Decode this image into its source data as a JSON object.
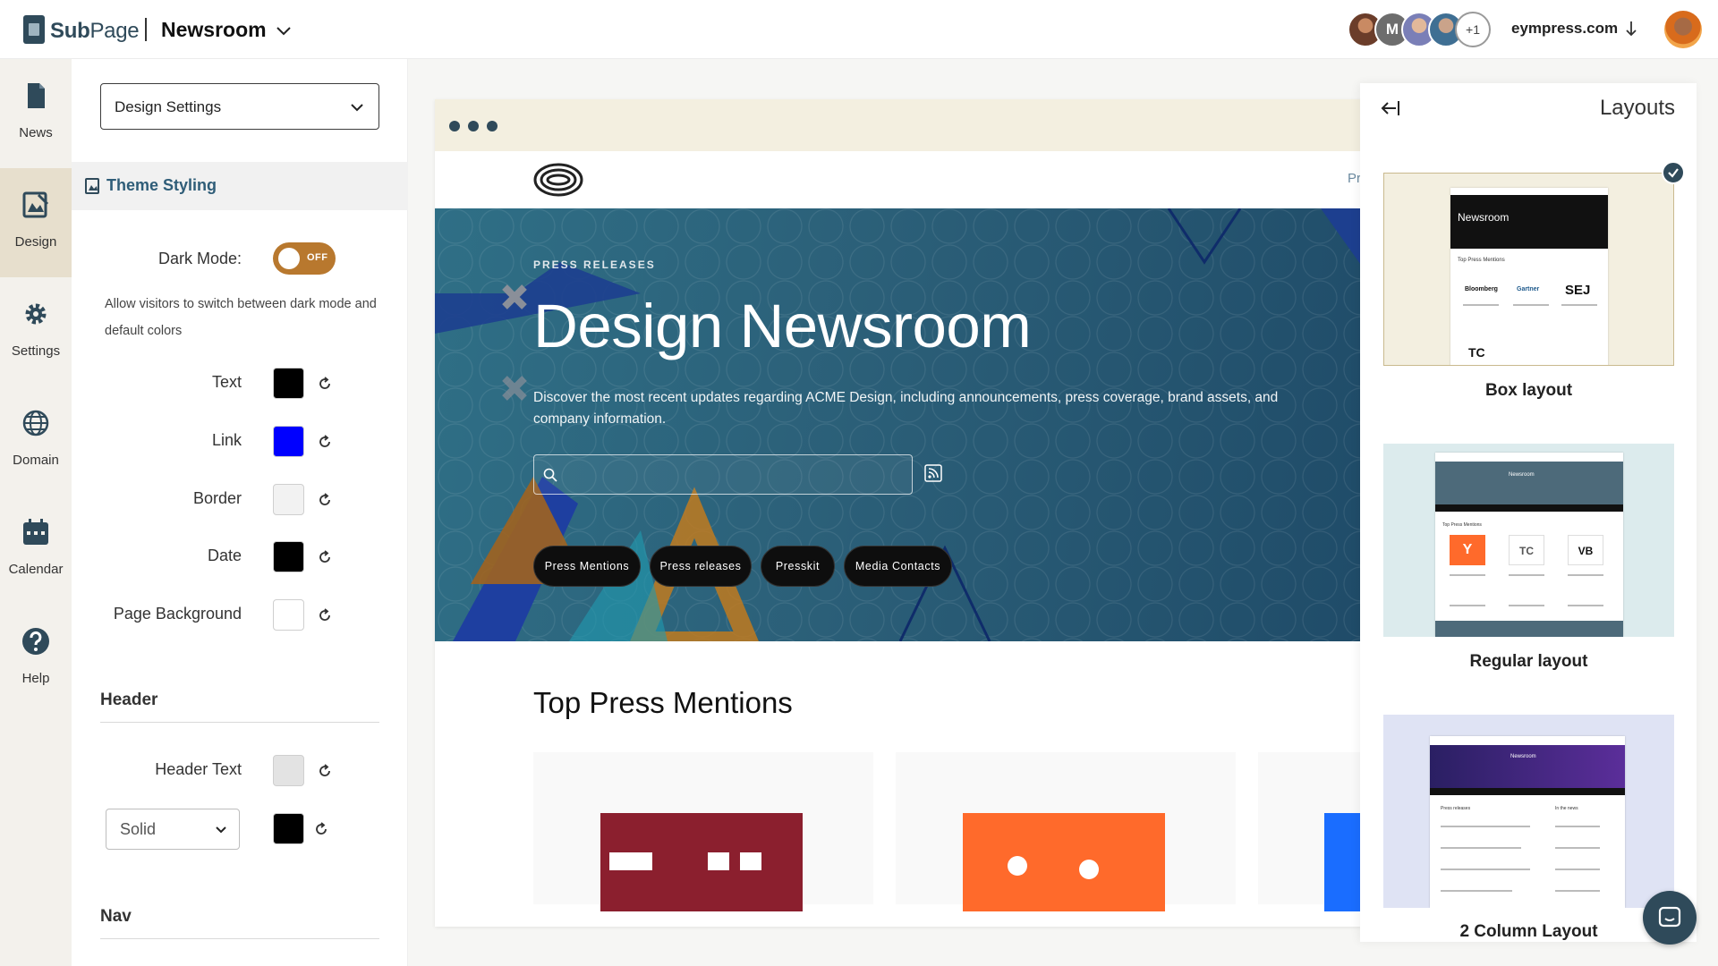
{
  "topbar": {
    "brand_bold": "Sub",
    "brand_light": "Page",
    "project_title": "Newsroom",
    "avatars": [
      {
        "initial": "",
        "icon": "user-photo-icon"
      },
      {
        "initial": "M",
        "icon": "user-initial-avatar"
      },
      {
        "initial": "",
        "icon": "user-photo-icon"
      },
      {
        "initial": "",
        "icon": "user-photo-icon"
      }
    ],
    "avatars_more": "+1",
    "domain": "eympress.com"
  },
  "rail": {
    "items": [
      {
        "label": "News",
        "icon": "document-icon",
        "active": false
      },
      {
        "label": "Design",
        "icon": "design-icon",
        "active": true
      },
      {
        "label": "Settings",
        "icon": "gear-icon",
        "active": false
      },
      {
        "label": "Domain",
        "icon": "globe-icon",
        "active": false
      },
      {
        "label": "Calendar",
        "icon": "calendar-icon",
        "active": false
      },
      {
        "label": "Help",
        "icon": "help-icon",
        "active": false
      }
    ]
  },
  "panel": {
    "select_value": "Design Settings",
    "section_title": "Theme Styling",
    "dark_mode_label": "Dark Mode:",
    "dark_mode_state": "OFF",
    "dark_mode_help": "Allow visitors to switch between dark mode and default colors",
    "colors": [
      {
        "label": "Text",
        "value": "#000000"
      },
      {
        "label": "Link",
        "value": "#0000ff"
      },
      {
        "label": "Border",
        "value": "#f2f2f2"
      },
      {
        "label": "Date",
        "value": "#000000"
      },
      {
        "label": "Page Background",
        "value": "#ffffff"
      }
    ],
    "header_group": "Header",
    "header_text_label": "Header Text",
    "header_text_color": "#e3e3e3",
    "header_style_value": "Solid",
    "header_style_color": "#000000",
    "nav_group": "Nav"
  },
  "preview": {
    "nav_peek": "Pr",
    "eyebrow": "PRESS RELEASES",
    "title": "Design Newsroom",
    "description": "Discover the most recent updates regarding ACME Design, including announcements, press coverage, brand assets, and company information.",
    "pills": [
      "Press Mentions",
      "Press releases",
      "Presskit",
      "Media Contacts"
    ],
    "section_heading": "Top Press Mentions",
    "card_colors": [
      "#8b1f2e",
      "#ff6a2b",
      "#1a6dff"
    ]
  },
  "layouts": {
    "title": "Layouts",
    "options": [
      {
        "label": "Box layout",
        "selected": true,
        "preview_title": "Newsroom",
        "preview_section": "Top Press Mentions",
        "logos": [
          "Bloomberg",
          "Gartner",
          "SEJ",
          "TC"
        ]
      },
      {
        "label": "Regular layout",
        "selected": false,
        "preview_title": "Newsroom",
        "preview_section": "Top Press Mentions",
        "logos": [
          "Y",
          "TC",
          "VB"
        ]
      },
      {
        "label": "2 Column Layout",
        "selected": false,
        "preview_title": "Newsroom",
        "preview_section": "Press releases",
        "preview_section_2": "In the news"
      }
    ]
  },
  "colors": {
    "brand": "#2f4a5a",
    "accent": "#b8782e",
    "link_blue": "#2f5d78",
    "hero": "#2b5f78"
  }
}
